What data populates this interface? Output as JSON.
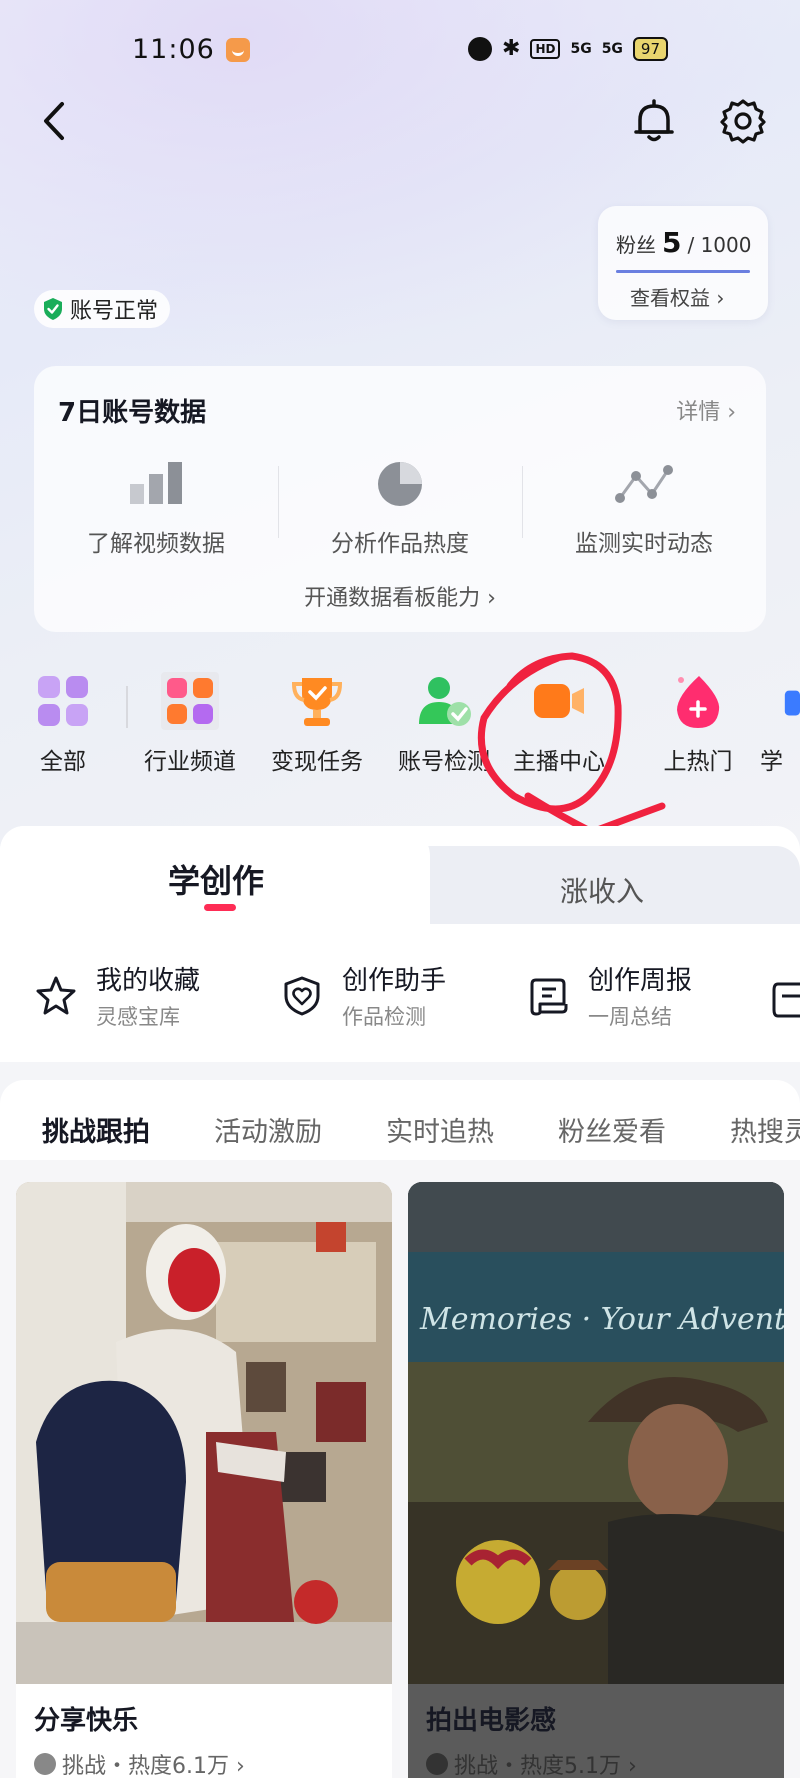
{
  "status_bar": {
    "time": "11:06",
    "signal_1": "5G",
    "signal_2": "5G",
    "hd": "HD",
    "battery": "97"
  },
  "header": {
    "back_icon": "chevron-left",
    "bell_icon": "bell",
    "gear_icon": "gear"
  },
  "fans": {
    "label": "粉丝",
    "count": "5",
    "total": "/ 1000",
    "progress": 0.005,
    "link": "查看权益 ›"
  },
  "account_status": {
    "label": "账号正常",
    "color": "#1aad5a"
  },
  "data_card": {
    "title": "7日账号数据",
    "more": "详情 ›",
    "items": [
      {
        "label": "了解视频数据",
        "icon": "bar-chart"
      },
      {
        "label": "分析作品热度",
        "icon": "pie-chart"
      },
      {
        "label": "监测实时动态",
        "icon": "line-trend"
      }
    ],
    "cta": "开通数据看板能力 ›"
  },
  "shortcuts": [
    {
      "label": "全部",
      "icon": "grid-squares",
      "color": "#b98cf0"
    },
    {
      "label": "行业频道",
      "icon": "industry-channel",
      "color": "#ff5a4f"
    },
    {
      "label": "变现任务",
      "icon": "trophy",
      "color": "#ff8a22"
    },
    {
      "label": "账号检测",
      "icon": "user-check",
      "color": "#34c759"
    },
    {
      "label": "主播中心",
      "icon": "video-camera",
      "color": "#ff7a1a"
    },
    {
      "label": "上热门",
      "icon": "flame-plus",
      "color": "#ff2d6f"
    },
    {
      "label": "学",
      "icon": "learn",
      "color": "#3b7bff"
    }
  ],
  "main_tabs": {
    "active": "学创作",
    "inactive": "涨收入",
    "accent": "#fe2c55"
  },
  "tools": [
    {
      "title": "我的收藏",
      "subtitle": "灵感宝库",
      "icon": "star"
    },
    {
      "title": "创作助手",
      "subtitle": "作品检测",
      "icon": "shield-heart"
    },
    {
      "title": "创作周报",
      "subtitle": "一周总结",
      "icon": "scroll"
    }
  ],
  "feed_tabs": [
    "挑战跟拍",
    "活动激励",
    "实时追热",
    "粉丝爱看",
    "热搜灵"
  ],
  "feed": [
    {
      "title": "分享快乐",
      "meta": "挑战・热度6.1万 ›",
      "image_desc": "spiderman-room"
    },
    {
      "title": "拍出电影感",
      "meta": "挑战・热度5.1万 ›",
      "banner_text": "Memories · Your Advent",
      "image_desc": "cowboy-movie"
    }
  ]
}
